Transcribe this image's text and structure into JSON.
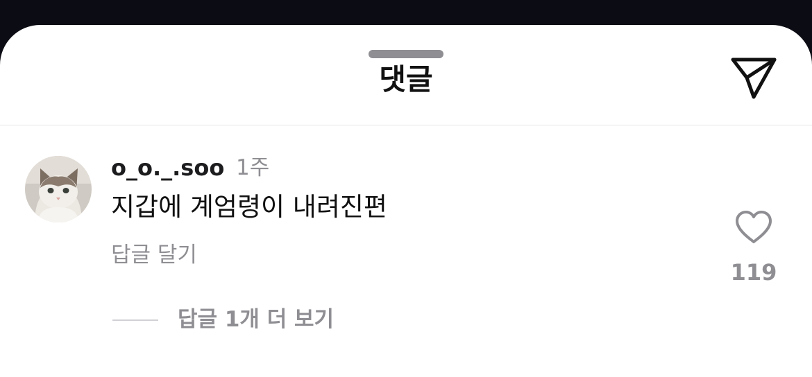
{
  "header": {
    "title": "댓글",
    "share_icon": "send-icon"
  },
  "comment": {
    "username": "o_o._.soo",
    "time": "1주",
    "text": "지갑에 계엄령이 내려진편",
    "reply_label": "답글 달기",
    "like_count": "119",
    "like_icon": "heart-icon",
    "avatar": "cat-avatar",
    "more_replies_label": "답글 1개 더 보기"
  },
  "colors": {
    "background": "#0c0c14",
    "sheet": "#ffffff",
    "primary_text": "#111111",
    "secondary_text": "#8e8e93"
  }
}
